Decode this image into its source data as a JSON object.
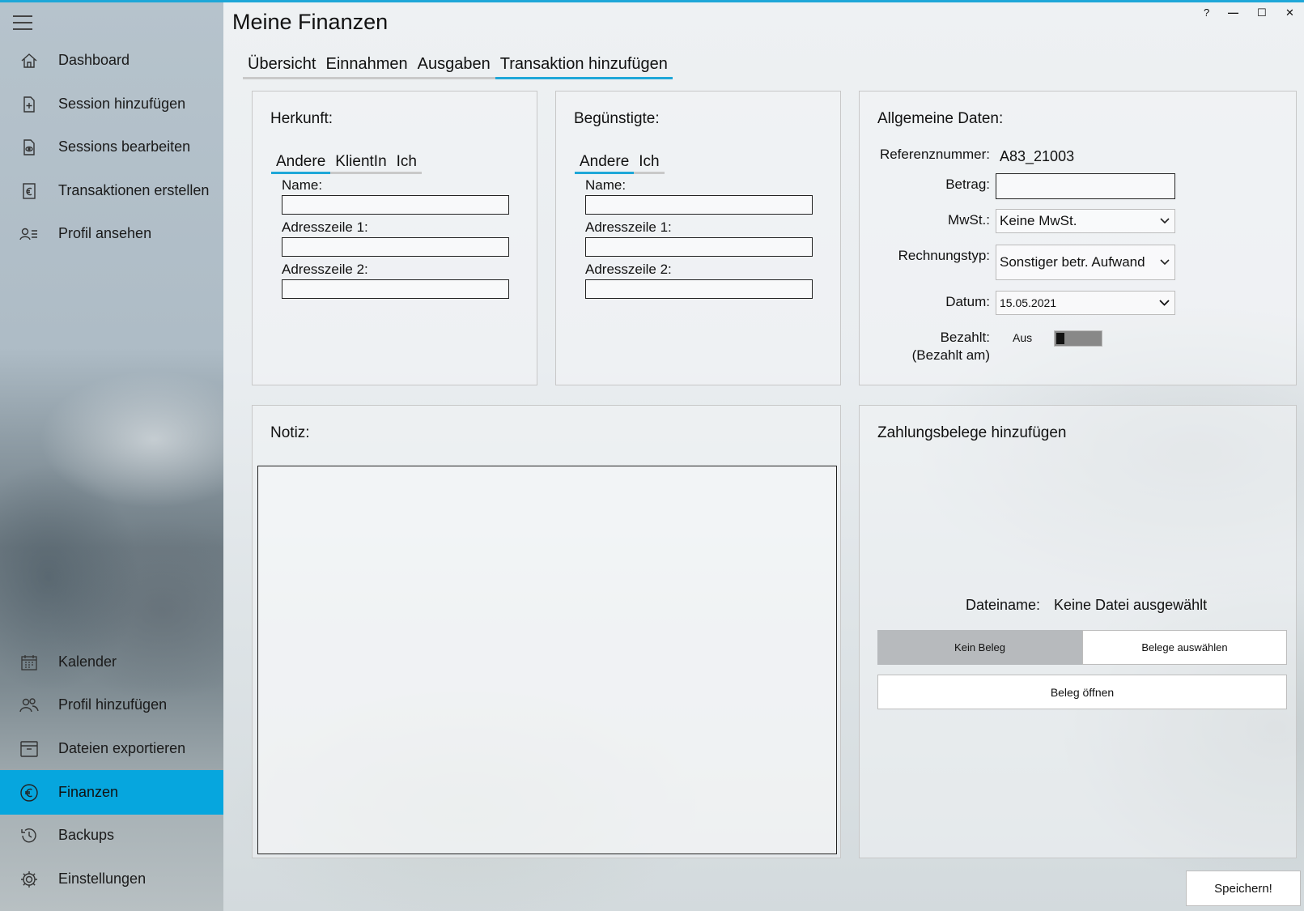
{
  "app": {
    "title": "Meine Finanzen"
  },
  "window_controls": {
    "help": "?",
    "minimize": "—",
    "maximize": "☐",
    "close": "✕"
  },
  "sidebar": {
    "top_items": [
      {
        "label": "Dashboard",
        "icon": "home-icon"
      },
      {
        "label": "Session hinzufügen",
        "icon": "file-add-icon"
      },
      {
        "label": "Sessions bearbeiten",
        "icon": "file-view-icon"
      },
      {
        "label": "Transaktionen erstellen",
        "icon": "euro-document-icon"
      },
      {
        "label": "Profil ansehen",
        "icon": "profile-icon"
      }
    ],
    "bottom_items": [
      {
        "label": "Kalender",
        "icon": "calendar-icon"
      },
      {
        "label": "Profil hinzufügen",
        "icon": "people-icon"
      },
      {
        "label": "Dateien exportieren",
        "icon": "archive-icon"
      },
      {
        "label": "Finanzen",
        "icon": "euro-icon",
        "active": true
      },
      {
        "label": "Backups",
        "icon": "history-icon"
      },
      {
        "label": "Einstellungen",
        "icon": "gear-icon"
      }
    ]
  },
  "tabs": [
    {
      "label": "Übersicht"
    },
    {
      "label": "Einnahmen"
    },
    {
      "label": "Ausgaben"
    },
    {
      "label": "Transaktion hinzufügen",
      "active": true
    }
  ],
  "herkunft": {
    "title": "Herkunft:",
    "subtabs": [
      "Andere",
      "KlientIn",
      "Ich"
    ],
    "name_label": "Name:",
    "addr1_label": "Adresszeile 1:",
    "addr2_label": "Adresszeile 2:",
    "name_value": "",
    "addr1_value": "",
    "addr2_value": ""
  },
  "beguenstigte": {
    "title": "Begünstigte:",
    "subtabs": [
      "Andere",
      "Ich"
    ],
    "name_label": "Name:",
    "addr1_label": "Adresszeile 1:",
    "addr2_label": "Adresszeile 2:",
    "name_value": "",
    "addr1_value": "",
    "addr2_value": ""
  },
  "allgemein": {
    "title": "Allgemeine Daten:",
    "ref_label": "Referenznummer:",
    "ref_value": "A83_21003",
    "betrag_label": "Betrag:",
    "betrag_value": "",
    "mwst_label": "MwSt.:",
    "mwst_value": "Keine MwSt.",
    "rtyp_label": "Rechnungstyp:",
    "rtyp_value": "Sonstiger betr. Aufwand",
    "datum_label": "Datum:",
    "datum_value": "15.05.2021",
    "bezahlt_label": "Bezahlt:",
    "bezahlt_am_label": "(Bezahlt am)",
    "bezahlt_state": "Aus"
  },
  "notiz": {
    "title": "Notiz:",
    "value": ""
  },
  "belege": {
    "title": "Zahlungsbelege hinzufügen",
    "dateiname_label": "Dateiname:",
    "dateiname_value": "Keine Datei ausgewählt",
    "kein_beleg": "Kein Beleg",
    "belege_auswaehlen": "Belege auswählen",
    "beleg_oeffnen": "Beleg öffnen"
  },
  "save_button": "Speichern!",
  "colors": {
    "accent": "#06a6de",
    "topline": "#1ea7d8"
  }
}
